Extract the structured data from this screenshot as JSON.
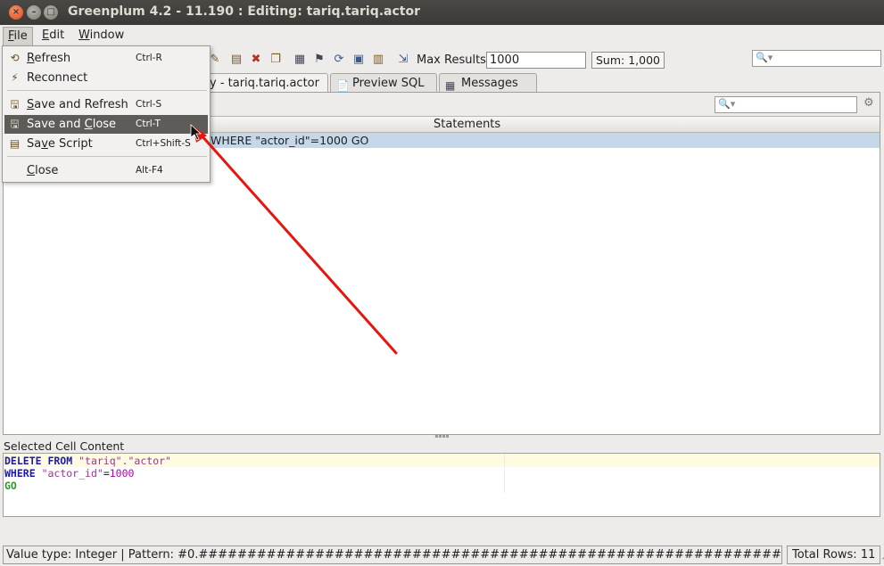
{
  "window": {
    "title": "Greenplum 4.2 - 11.190 : Editing: tariq.tariq.actor"
  },
  "menubar": {
    "items": [
      {
        "label": "File",
        "u": "F",
        "rest": "ile"
      },
      {
        "label": "Edit",
        "u": "E",
        "rest": "dit"
      },
      {
        "label": "Window",
        "u": "W",
        "rest": "indow"
      }
    ]
  },
  "toolbar": {
    "max_results_label": "Max Results:",
    "max_results_value": "1000",
    "sum_label": "Sum: 1,000"
  },
  "tabs": [
    {
      "label": "y - tariq.tariq.actor"
    },
    {
      "label": "Preview SQL"
    },
    {
      "label": "Messages"
    }
  ],
  "table": {
    "column_header": "Statements",
    "row_text": "WHERE \"actor_id\"=1000 GO"
  },
  "cell_content": {
    "label": "Selected Cell Content",
    "line1_kw": "DELETE FROM",
    "line1_str": "\"tariq\".\"actor\"",
    "line2_kw": "WHERE",
    "line2_str": "\"actor_id\"",
    "line2_eq": "=",
    "line2_num": "1000",
    "line3": "GO"
  },
  "status": {
    "value_type": "Value type: Integer | Pattern: #0.######################################################################",
    "total_rows": "Total Rows: 11"
  },
  "file_menu": {
    "items": [
      {
        "u": "R",
        "rest": "efresh",
        "shortcut": "Ctrl-R",
        "icon": "refresh-icon"
      },
      {
        "u": "",
        "rest": "Reconnect",
        "shortcut": "",
        "icon": "reconnect-icon"
      },
      {
        "u": "S",
        "rest": "ave and Refresh",
        "shortcut": "Ctrl-S",
        "icon": "save-refresh-icon"
      },
      {
        "pre": "Save and ",
        "u": "C",
        "rest": "lose",
        "shortcut": "Ctrl-T",
        "icon": "save-close-icon"
      },
      {
        "pre": "Sa",
        "u": "v",
        "rest": "e Script",
        "shortcut": "Ctrl+Shift-S",
        "icon": "save-script-icon"
      },
      {
        "u": "C",
        "rest": "lose",
        "shortcut": "Alt-F4",
        "icon": ""
      }
    ]
  },
  "colors": {
    "annotation_arrow": "#e8150f",
    "selected_row": "#c6d7ea",
    "menu_selected": "#5e5c58"
  }
}
